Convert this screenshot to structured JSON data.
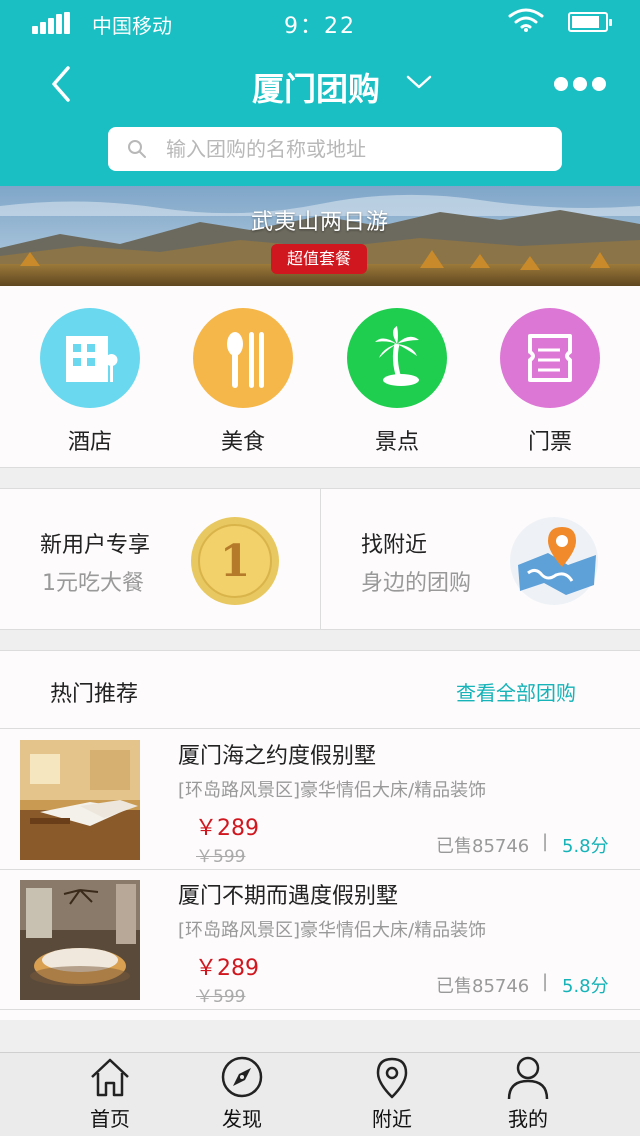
{
  "status_bar": {
    "carrier": "中国移动",
    "time": "9：22",
    "battery_level": 0.85
  },
  "nav": {
    "title": "厦门团购",
    "back_icon": "back-arrow-icon",
    "dropdown_icon": "chevron-down-icon",
    "more_icon": "more-dots-icon"
  },
  "search": {
    "placeholder": "输入团购的名称或地址"
  },
  "banner": {
    "title": "武夷山两日游",
    "badge": "超值套餐"
  },
  "categories": [
    {
      "label": "酒店",
      "icon": "hotel-icon",
      "color": "#6ad8ef"
    },
    {
      "label": "美食",
      "icon": "food-icon",
      "color": "#f6b74a"
    },
    {
      "label": "景点",
      "icon": "palm-tree-icon",
      "color": "#1fce4f"
    },
    {
      "label": "门票",
      "icon": "ticket-icon",
      "color": "#dd77d6"
    }
  ],
  "promos": {
    "new_user": {
      "title": "新用户专享",
      "subtitle": "1元吃大餐",
      "icon": "coin-icon",
      "coin_text": "1"
    },
    "nearby": {
      "title": "找附近",
      "subtitle": "身边的团购",
      "icon": "map-pin-icon"
    }
  },
  "hot": {
    "title": "热门推荐",
    "view_all": "查看全部团购"
  },
  "deals": [
    {
      "name": "厦门海之约度假别墅",
      "desc": "[环岛路风景区]豪华情侣大床/精品装饰",
      "price": "￥289",
      "old_price": "￥599",
      "sold": "已售85746",
      "sep": "|",
      "score": "5.8分"
    },
    {
      "name": "厦门不期而遇度假别墅",
      "desc": "[环岛路风景区]豪华情侣大床/精品装饰",
      "price": "￥289",
      "old_price": "￥599",
      "sold": "已售85746",
      "sep": "|",
      "score": "5.8分"
    }
  ],
  "tabs": [
    {
      "label": "首页",
      "icon": "home-icon"
    },
    {
      "label": "发现",
      "icon": "compass-icon"
    },
    {
      "label": "附近",
      "icon": "location-pin-icon"
    },
    {
      "label": "我的",
      "icon": "user-icon"
    }
  ],
  "colors": {
    "brand": "#1abfc3",
    "price": "#d0161e",
    "link": "#16b3b8"
  }
}
